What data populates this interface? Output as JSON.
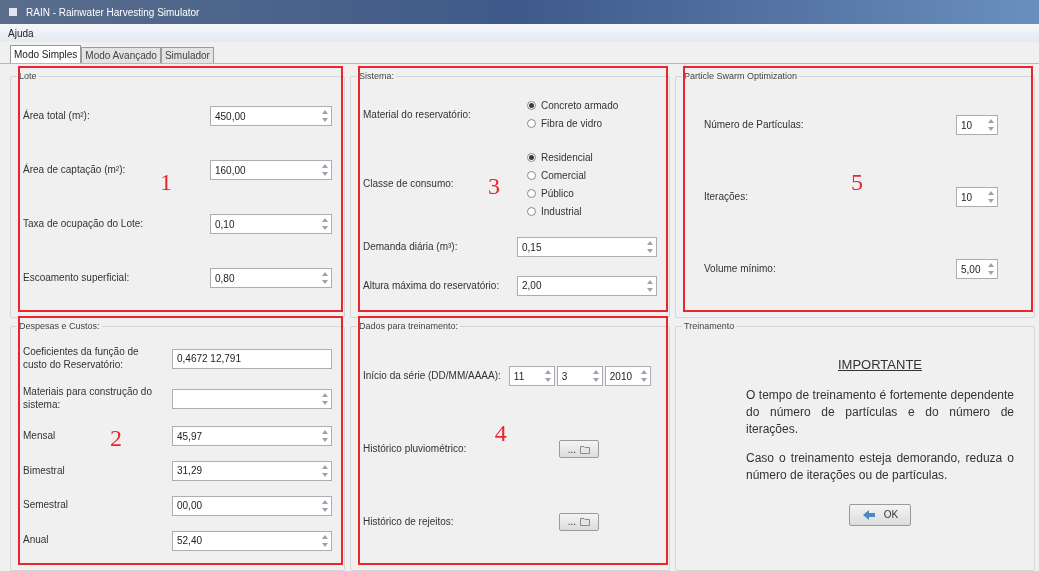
{
  "window": {
    "title": "RAIN - Rainwater Harvesting Simulator"
  },
  "menu": [
    "Ajuda"
  ],
  "tabs": [
    {
      "label": "Modo Simples",
      "selected": true
    },
    {
      "label": "Modo Avançado",
      "selected": false
    },
    {
      "label": "Simulador",
      "selected": false
    }
  ],
  "columns": [
    {
      "groups": [
        {
          "title": "Lote",
          "annotation": "1",
          "rows": [
            {
              "kind": "spin",
              "label": "Área total (m²):",
              "value": "450,00"
            },
            {
              "kind": "spin",
              "label": "Área de captação (m²):",
              "value": "160,00"
            },
            {
              "kind": "spin",
              "label": "Taxa de ocupação do Lote:",
              "value": "0,10"
            },
            {
              "kind": "spin",
              "label": "Escoamento superficial:",
              "value": "0,80"
            }
          ]
        },
        {
          "title": "Despesas e Custos:",
          "annotation": "2",
          "rows": [
            {
              "kind": "text",
              "label": "Coeficientes da função de custo do Reservatório:",
              "value": "0,4672 12,791"
            },
            {
              "kind": "spin",
              "label": "Materiais para construção do sistema:"
            },
            {
              "kind": "spin",
              "label": "Mensal",
              "value": "45,97"
            },
            {
              "kind": "spin",
              "label": "Bimestral",
              "value": "31,29"
            },
            {
              "kind": "spin",
              "label": "Semestral",
              "value": "00,00"
            },
            {
              "kind": "spin",
              "label": "Anual",
              "value": "52,40"
            }
          ]
        }
      ]
    },
    {
      "groups": [
        {
          "title": "Sistema:",
          "annotation": "3",
          "rows": [
            {
              "kind": "radio",
              "label": "Material do reservatório:",
              "options": [
                {
                  "label": "Concreto armado",
                  "selected": true
                },
                {
                  "label": "Fibra de vidro",
                  "selected": false
                }
              ]
            },
            {
              "kind": "radio",
              "label": "Classe de consumo:",
              "options": [
                {
                  "label": "Residencial",
                  "selected": true
                },
                {
                  "label": "Comercial",
                  "selected": false
                },
                {
                  "label": "Público",
                  "selected": false
                },
                {
                  "label": "Industrial",
                  "selected": false
                }
              ]
            },
            {
              "kind": "spin",
              "label": "Demanda diária (m³):",
              "value": "0,15"
            },
            {
              "kind": "spin",
              "label": "Altura máxima do reservatório:",
              "value": "2,00"
            }
          ]
        },
        {
          "title": "Dados para treinamento:",
          "annotation": "4",
          "rows": [
            {
              "kind": "date",
              "label": "Início da série (DD/MM/AAAA):",
              "values": [
                "11",
                "3",
                "2010"
              ]
            },
            {
              "kind": "browse",
              "label": "Histórico pluviométrico:",
              "button": "..."
            },
            {
              "kind": "browse",
              "label": "Histórico de rejeitos:",
              "button": "..."
            }
          ]
        }
      ]
    },
    {
      "groups": [
        {
          "title": "Particle Swarm Optimization",
          "annotation": "5",
          "rows": [
            {
              "kind": "small",
              "label": "Número de Partículas:",
              "value": "10"
            },
            {
              "kind": "small",
              "label": "Iterações:",
              "value": "10"
            },
            {
              "kind": "small",
              "label": "Volume mínimo:",
              "value": "5,00"
            }
          ]
        },
        {
          "title": "Treinamento",
          "rows": [
            {
              "kind": "notice",
              "heading": "IMPORTANTE",
              "paragraphs": [
                "O tempo de treinamento é fortemente dependente do número de partículas e do número de iterações.",
                "Caso o treinamento esteja demorando, reduza o número de iterações ou de partículas."
              ],
              "button": "OK"
            }
          ]
        }
      ]
    }
  ]
}
